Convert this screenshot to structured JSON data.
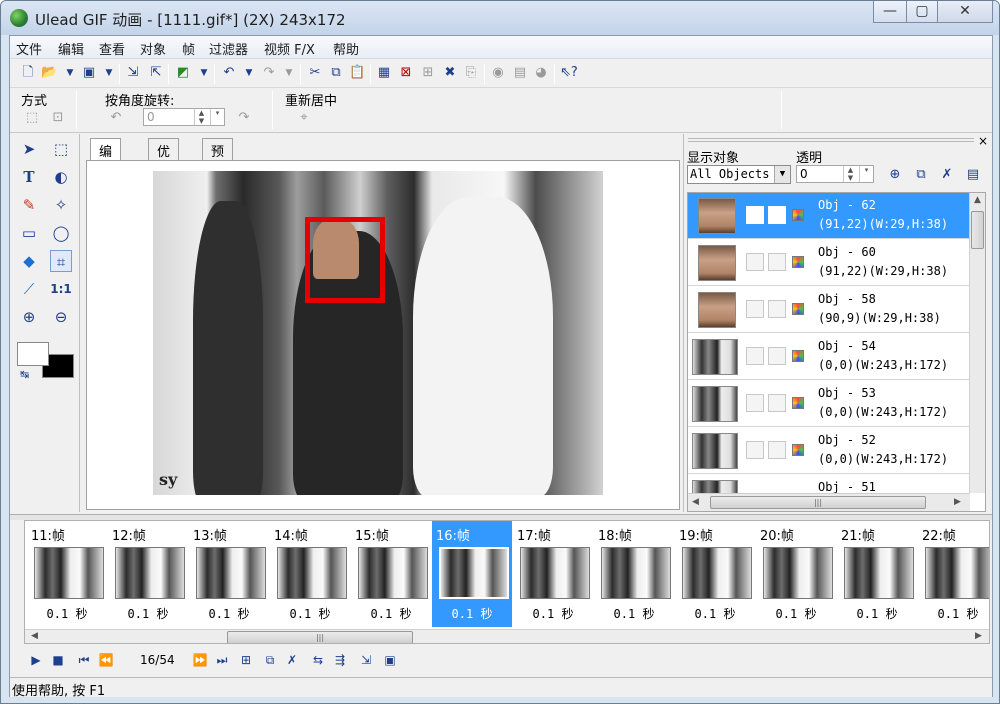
{
  "window": {
    "title": "Ulead GIF 动画 - [1111.gif*] (2X) 243x172",
    "min": "—",
    "max": "▢",
    "close": "✕"
  },
  "menu": [
    "文件",
    "编辑",
    "查看",
    "对象",
    "帧",
    "过滤器",
    "视频 F/X",
    "帮助"
  ],
  "toolbar_icons": [
    "new-icon",
    "open-icon",
    "dropdown-icon",
    "save-icon",
    "dropdown-icon",
    "import-icon",
    "export-icon",
    "preview-browser-icon",
    "dropdown-icon",
    "undo-icon",
    "dropdown-icon",
    "redo-icon",
    "dropdown-icon",
    "cut-icon",
    "copy-icon",
    "paste-icon",
    "frame-panel-icon",
    "delete-frame-icon",
    "add-frame-icon",
    "crop-icon",
    "duplicate-icon",
    "optimize-icon",
    "flatten-icon",
    "disk-icon",
    "help-pointer-icon"
  ],
  "attributes": {
    "mode_label": "方式",
    "rotate_label": "按角度旋转:",
    "rotate_value": "0",
    "recenter_label": "重新居中"
  },
  "tabs": [
    "编辑",
    "优化",
    "预览"
  ],
  "objects_panel": {
    "show_label": "显示对象",
    "show_value": "All Objects",
    "opacity_label": "透明",
    "opacity_value": "0",
    "items": [
      {
        "name": "Obj - 62",
        "pos": "(91,22)(W:29,H:38)",
        "thumb": "face",
        "selected": true
      },
      {
        "name": "Obj - 60",
        "pos": "(91,22)(W:29,H:38)",
        "thumb": "face",
        "selected": false
      },
      {
        "name": "Obj - 58",
        "pos": "(90,9)(W:29,H:38)",
        "thumb": "face",
        "selected": false
      },
      {
        "name": "Obj - 54",
        "pos": "(0,0)(W:243,H:172)",
        "thumb": "full",
        "selected": false
      },
      {
        "name": "Obj - 53",
        "pos": "(0,0)(W:243,H:172)",
        "thumb": "full",
        "selected": false
      },
      {
        "name": "Obj - 52",
        "pos": "(0,0)(W:243,H:172)",
        "thumb": "full",
        "selected": false
      },
      {
        "name": "Obj - 51",
        "pos": "",
        "thumb": "full",
        "selected": false
      }
    ]
  },
  "frames": [
    {
      "label": "11:帧",
      "delay": "0.1 秒",
      "selected": false
    },
    {
      "label": "12:帧",
      "delay": "0.1 秒",
      "selected": false
    },
    {
      "label": "13:帧",
      "delay": "0.1 秒",
      "selected": false
    },
    {
      "label": "14:帧",
      "delay": "0.1 秒",
      "selected": false
    },
    {
      "label": "15:帧",
      "delay": "0.1 秒",
      "selected": false
    },
    {
      "label": "16:帧",
      "delay": "0.1 秒",
      "selected": true
    },
    {
      "label": "17:帧",
      "delay": "0.1 秒",
      "selected": false
    },
    {
      "label": "18:帧",
      "delay": "0.1 秒",
      "selected": false
    },
    {
      "label": "19:帧",
      "delay": "0.1 秒",
      "selected": false
    },
    {
      "label": "20:帧",
      "delay": "0.1 秒",
      "selected": false
    },
    {
      "label": "21:帧",
      "delay": "0.1 秒",
      "selected": false
    },
    {
      "label": "22:帧",
      "delay": "0.1 秒",
      "selected": false
    }
  ],
  "playback": {
    "counter": "16/54"
  },
  "status": "使用帮助, 按 F1",
  "canvas": {
    "watermark": "sy"
  },
  "colors": {
    "selection": "#3399ff",
    "crop_box": "#e40000",
    "foreground": "#ffffff",
    "background": "#000000"
  }
}
